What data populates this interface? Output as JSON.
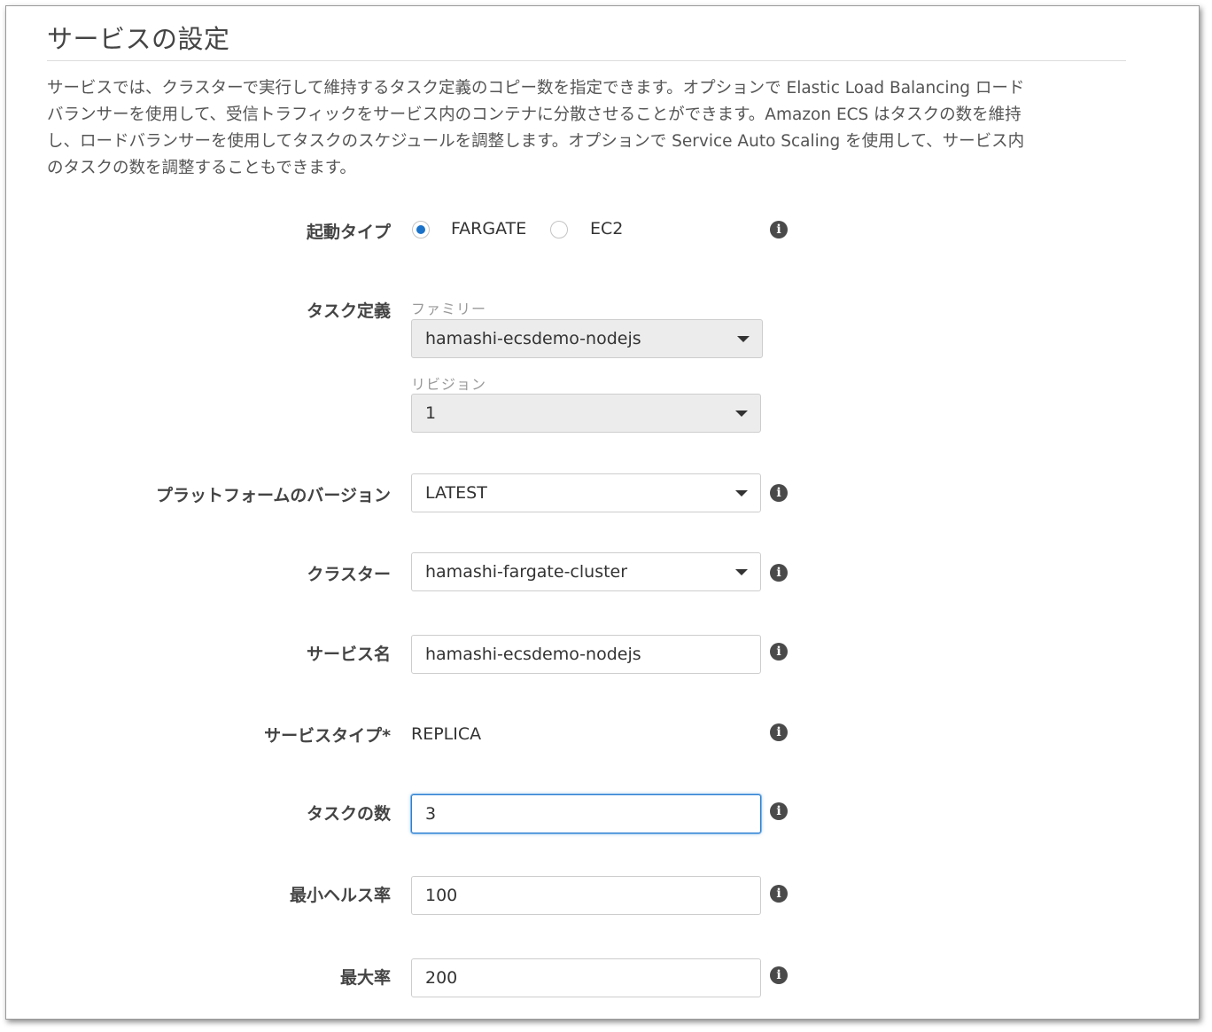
{
  "section": {
    "title": "サービスの設定",
    "description_lines": [
      "サービスでは、クラスターで実行して維持するタスク定義のコピー数を指定できます。オプションで Elastic Load Balancing ロード",
      "バランサーを使用して、受信トラフィックをサービス内のコンテナに分散させることができます。Amazon ECS はタスクの数を維持",
      "し、ロードバランサーを使用してタスクのスケジュールを調整します。オプションで Service Auto Scaling を使用して、サービス内",
      "のタスクの数を調整することもできます。"
    ]
  },
  "launch_type": {
    "label": "起動タイプ",
    "options": [
      {
        "label": "FARGATE",
        "selected": true
      },
      {
        "label": "EC2",
        "selected": false
      }
    ]
  },
  "task_definition": {
    "label": "タスク定義",
    "family_label": "ファミリー",
    "family_value": "hamashi-ecsdemo-nodejs",
    "revision_label": "リビジョン",
    "revision_value": "1"
  },
  "platform_version": {
    "label": "プラットフォームのバージョン",
    "value": "LATEST"
  },
  "cluster": {
    "label": "クラスター",
    "value": "hamashi-fargate-cluster"
  },
  "service_name": {
    "label": "サービス名",
    "value": "hamashi-ecsdemo-nodejs"
  },
  "service_type": {
    "label": "サービスタイプ*",
    "value": "REPLICA"
  },
  "task_count": {
    "label": "タスクの数",
    "value": "3"
  },
  "min_healthy": {
    "label": "最小ヘルス率",
    "value": "100"
  },
  "max_percent": {
    "label": "最大率",
    "value": "200"
  },
  "info_glyph": "i",
  "icons": {
    "info": "info-icon",
    "dropdown": "chevron-down-icon"
  },
  "colors": {
    "radio_selected": "#1a73c9",
    "focus_border": "#2d7fd0"
  }
}
